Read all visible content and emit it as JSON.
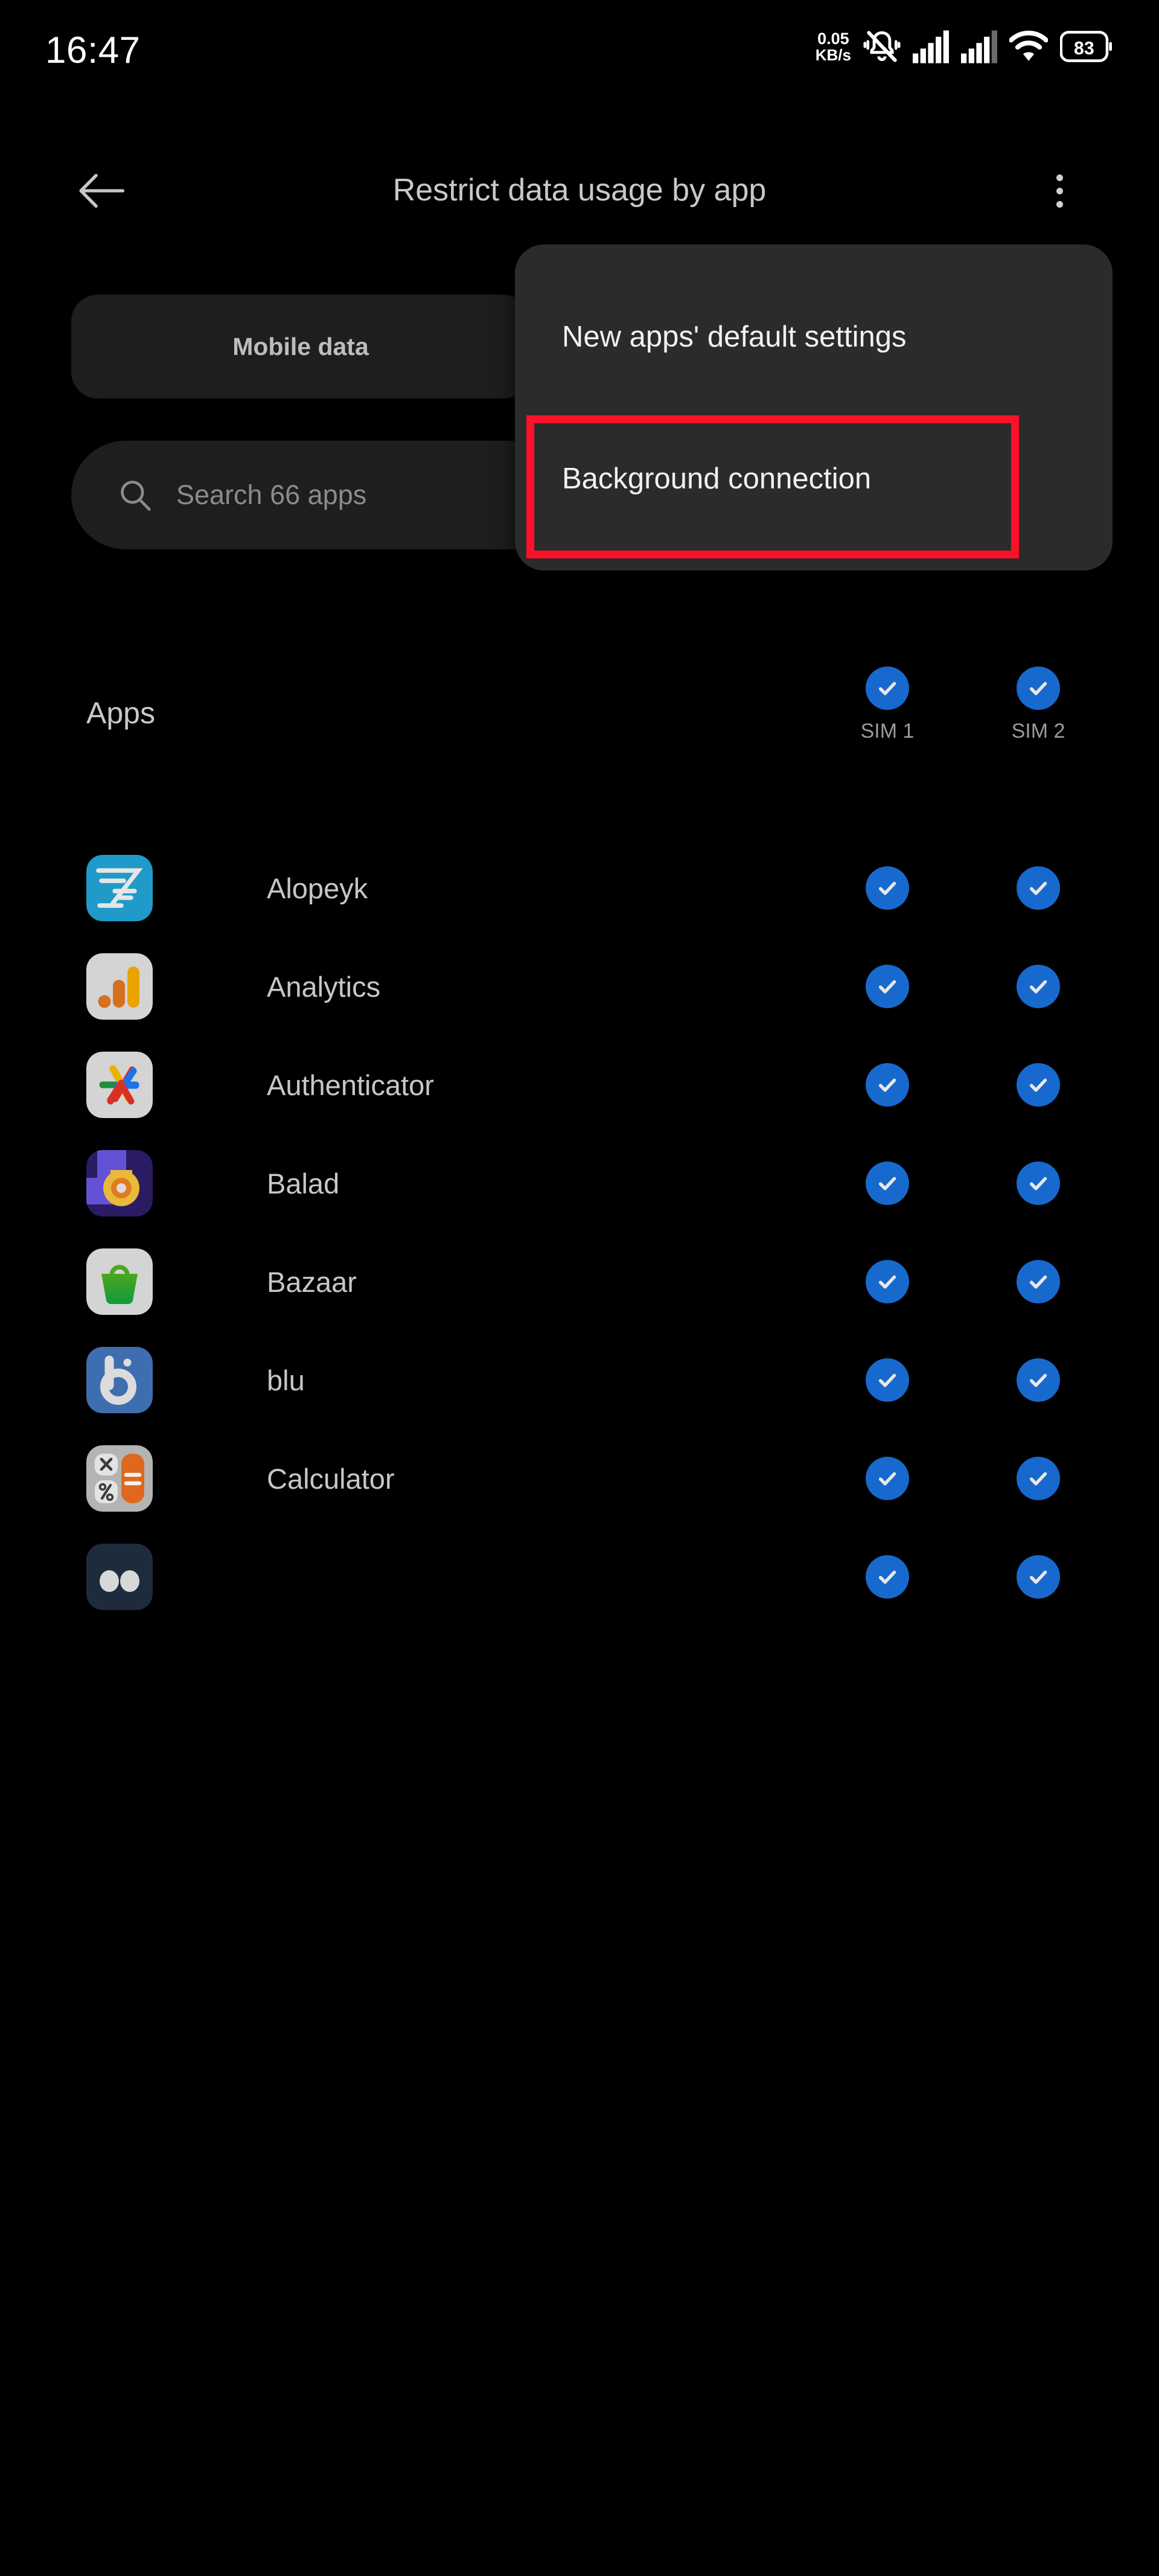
{
  "statusbar": {
    "time": "16:47",
    "net_speed_value": "0.05",
    "net_speed_unit": "KB/s",
    "icons": [
      "silent-bell-icon",
      "signal-sim1-icon",
      "signal-sim2-icon",
      "wifi-icon",
      "battery-icon"
    ],
    "battery_percent": "83"
  },
  "appbar": {
    "back_label": "back-arrow",
    "title": "Restrict data usage by app",
    "overflow_label": "more-options"
  },
  "tabs": [
    {
      "label": "Mobile data",
      "selected": true
    }
  ],
  "search": {
    "placeholder": "Search 66 apps",
    "value": "",
    "icon": "search-icon",
    "app_count": "66"
  },
  "menu": {
    "visible": true,
    "items": [
      {
        "label": "New apps' default settings",
        "highlighted": false
      },
      {
        "label": "Background connection",
        "highlighted": true
      }
    ],
    "highlight_color": "#fb1229",
    "background_color": "#2b2b2b"
  },
  "list_header": {
    "title": "Apps",
    "columns": [
      {
        "label": "SIM 1",
        "checked": true
      },
      {
        "label": "SIM 2",
        "checked": true
      }
    ]
  },
  "checkbox_color": "#1769cd",
  "apps": [
    {
      "name": "Alopeyk",
      "icon": "alopeyk-icon",
      "sim1": true,
      "sim2": true
    },
    {
      "name": "Analytics",
      "icon": "analytics-icon",
      "sim1": true,
      "sim2": true
    },
    {
      "name": "Authenticator",
      "icon": "authenticator-icon",
      "sim1": true,
      "sim2": true
    },
    {
      "name": "Balad",
      "icon": "balad-icon",
      "sim1": true,
      "sim2": true
    },
    {
      "name": "Bazaar",
      "icon": "bazaar-icon",
      "sim1": true,
      "sim2": true
    },
    {
      "name": "blu",
      "icon": "blu-icon",
      "sim1": true,
      "sim2": true
    },
    {
      "name": "Calculator",
      "icon": "calculator-icon",
      "sim1": true,
      "sim2": true
    },
    {
      "name": "",
      "icon": "partial-app-icon",
      "sim1": true,
      "sim2": true
    }
  ]
}
